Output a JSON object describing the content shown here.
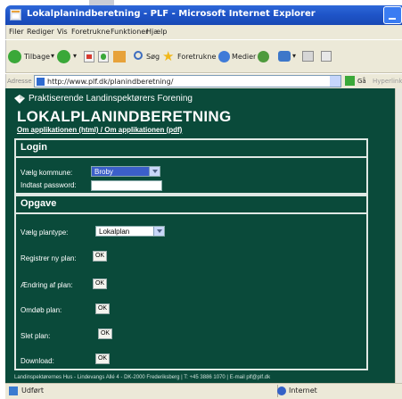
{
  "window": {
    "title": "Lokalplanindberetning - PLF - Microsoft Internet Explorer"
  },
  "menu": [
    "Filer",
    "Rediger",
    "Vis",
    "Foretrukne",
    "Funktioner",
    "Hjælp"
  ],
  "toolbar": {
    "back": "Tilbage",
    "search": "Søg",
    "favorites": "Foretrukne",
    "media": "Medier"
  },
  "address": {
    "label": "Adresse",
    "url": "http://www.plf.dk/planindberetning/",
    "go": "Gå",
    "links": "Hyperlinks"
  },
  "page": {
    "org": "Praktiserende Landinspektørers Forening",
    "title": "LOKALPLANINDBERETNING",
    "about_links": "Om applikationen (html) / Om applikationen (pdf)",
    "login": {
      "header": "Login",
      "kommune_label": "Vælg kommune:",
      "kommune_value": "Broby",
      "password_label": "Indtast password:"
    },
    "opgave": {
      "header": "Opgave",
      "plantype_label": "Vælg plantype:",
      "plantype_value": "Lokalplan",
      "actions": [
        {
          "label": "Registrer ny plan:",
          "button": "OK"
        },
        {
          "label": "Ændring af plan:",
          "button": "OK"
        },
        {
          "label": "Omdøb plan:",
          "button": "OK"
        },
        {
          "label": "Slet plan:",
          "button": "OK"
        },
        {
          "label": "Download:",
          "button": "OK"
        }
      ]
    },
    "footer": "Landinspektørernes Hus - Lindevangs Allé 4 - DK-2000 Frederiksberg | T: +45 3886 1070 | E-mail plf@plf.dk"
  },
  "status": {
    "done": "Udført",
    "zone": "Internet"
  },
  "colors": {
    "page_bg": "#0a4a3a",
    "titlebar": "#1f55c9",
    "select_highlight": "#3b5fc9"
  }
}
